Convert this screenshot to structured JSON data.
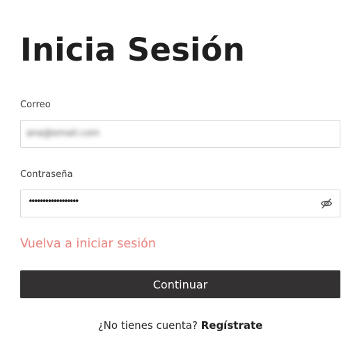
{
  "login": {
    "title": "Inicia Sesión",
    "email": {
      "label": "Correo",
      "value": "ana@email.com"
    },
    "password": {
      "label": "Contraseña",
      "masked_value": "••••••••••••••••••",
      "toggle_icon": "eye-slash-icon"
    },
    "relogin_link": "Vuelva a iniciar sesión",
    "continue_label": "Continuar",
    "signup": {
      "prompt": "¿No tienes cuenta?",
      "link": "Regístrate"
    }
  },
  "colors": {
    "background": "#ffffff",
    "title": "#1f1f1f",
    "input_border": "#d7d7d7",
    "link_accent": "#e8827d",
    "button_bg": "#333132",
    "button_text": "#ffffff"
  }
}
